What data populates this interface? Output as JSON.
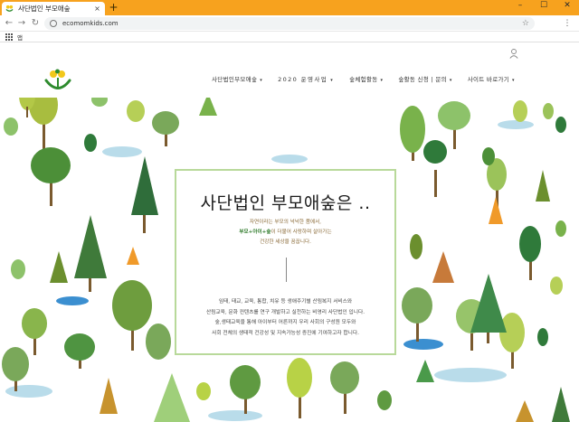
{
  "browser": {
    "tab_title": "사단법인 부모애숲",
    "tab_close": "×",
    "new_tab": "+",
    "url": "ecomomkids.com",
    "bookmarks_apps_label": "앱",
    "window_minimize": "–",
    "window_maximize": "☐",
    "window_close": "✕",
    "back": "←",
    "forward": "→",
    "reload": "↻",
    "star": "☆",
    "menu": "⋮"
  },
  "header": {
    "nav": [
      {
        "label": "사단법인부모애숲"
      },
      {
        "label": "2020 운영사업"
      },
      {
        "label": "숲체험활동"
      },
      {
        "label": "숲활동 신청 | 문의"
      },
      {
        "label": "사이트 바로가기"
      }
    ],
    "caret": "▾"
  },
  "card": {
    "title": "사단법인 부모애숲은 ..",
    "intro_line1": "자연이라는 부모의 넉넉한 품에서,",
    "intro_line2_bold": "부모+아이+숲",
    "intro_line2_rest": "이 더불어 사랑하며 살아가는",
    "intro_line3": "건강한 세상을 꿈꿉니다.",
    "desc_lines": [
      "임태, 태교, 교육, 통합, 치유 등 생애주기별 산림복지 서비스와",
      "산림교육, 문화 컨텐츠를 연구 개발하고 실천하는 비영리 사단법인 입니다.",
      "숲,생태교육을 통해 아이부터 어른까지 우리 사회의 구성원 모두와",
      "사회 전체의 생태적 건강성 및 지속가능성 증진에 기여하고자 합니다."
    ]
  },
  "colors": {
    "chrome": "#f7a21e",
    "card_border": "#b8d99a",
    "brand_green": "#2e7a2a"
  }
}
